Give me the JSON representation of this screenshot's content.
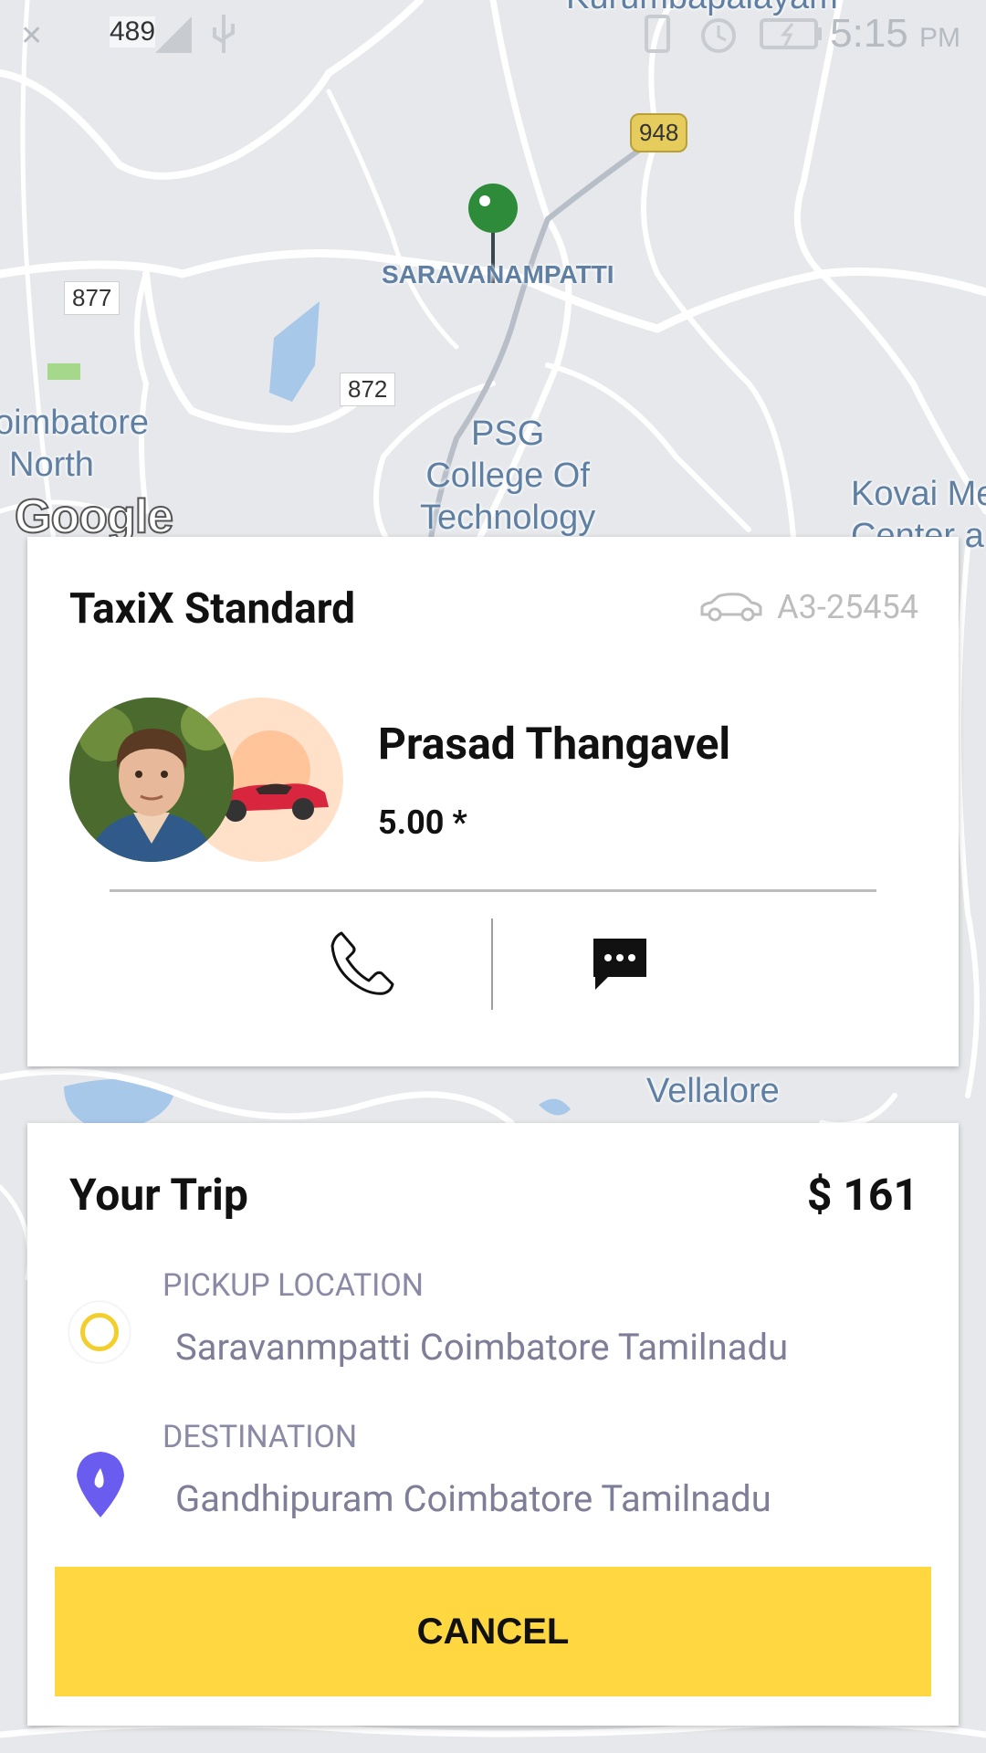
{
  "status_bar": {
    "time": "5:15",
    "ampm": "PM",
    "signal_number": "489"
  },
  "map": {
    "labels": {
      "saravanampatti": "SARAVANAMPATTI",
      "coimbatore_north_1": "oimbatore",
      "coimbatore_north_2": "North",
      "psg_1": "PSG",
      "psg_2": "College Of",
      "psg_3": "Technology",
      "kovai_1": "Kovai Me",
      "kovai_2": "Center a",
      "vellalore": "Vellalore",
      "top_partial": "Kurumbapalayam"
    },
    "shields": {
      "r877": "877",
      "r872": "872",
      "r948": "948"
    },
    "google_logo": "Google",
    "pin_color": "#2e8b3a"
  },
  "driver_card": {
    "service": "TaxiX Standard",
    "plate": "A3-25454",
    "driver_name": "Prasad Thangavel",
    "rating": "5.00 *"
  },
  "trip_card": {
    "title": "Your Trip",
    "price": "$ 161",
    "pickup_label": "PICKUP LOCATION",
    "pickup_value": "Saravanmpatti Coimbatore Tamilnadu",
    "destination_label": "DESTINATION",
    "destination_value": "Gandhipuram Coimbatore Tamilnadu",
    "cancel_label": "CANCEL"
  },
  "colors": {
    "accent_yellow": "#ffd740",
    "destination_purple": "#6b5cf0",
    "pickup_ring": "#f3cf2e"
  }
}
